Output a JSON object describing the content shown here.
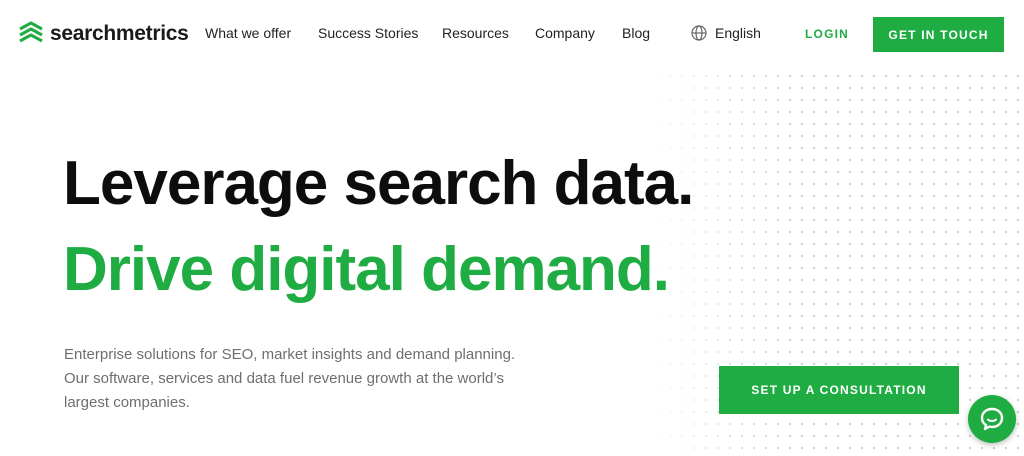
{
  "brand": {
    "name": "searchmetrics",
    "accent": "#1fad43"
  },
  "nav": {
    "items": [
      "What we offer",
      "Success Stories",
      "Resources",
      "Company",
      "Blog"
    ],
    "language": "English",
    "login": "LOGIN",
    "cta": "GET IN TOUCH"
  },
  "hero": {
    "headline": "Leverage search data.",
    "subline": "Drive digital demand.",
    "description": "Enterprise solutions for SEO, market insights and demand planning. Our software, services and data fuel revenue growth at the world’s largest companies.",
    "cta": "SET UP A CONSULTATION"
  },
  "icons": {
    "logo": "searchmetrics-logo-icon",
    "language": "globe-icon",
    "chat": "chat-bubble-icon"
  }
}
